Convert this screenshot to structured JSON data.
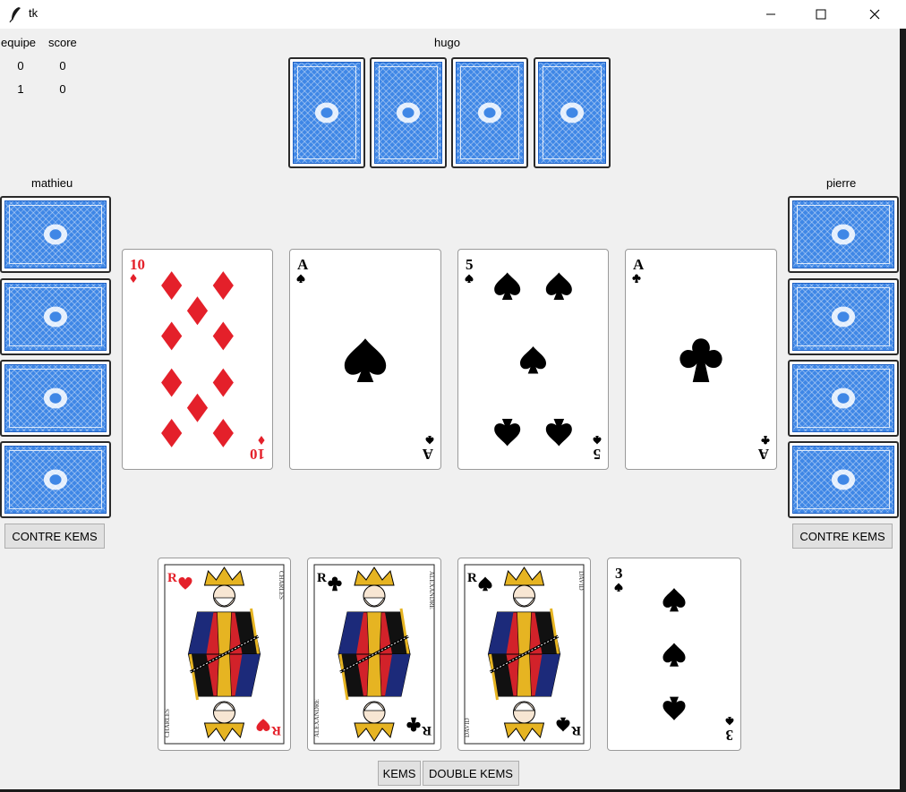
{
  "window": {
    "title": "tk"
  },
  "scoreboard": {
    "headers": [
      "equipe",
      "score"
    ],
    "rows": [
      [
        "0",
        "0"
      ],
      [
        "1",
        "0"
      ]
    ]
  },
  "players": {
    "top": {
      "name": "hugo"
    },
    "left": {
      "name": "mathieu",
      "contre_label": "CONTRE KEMS"
    },
    "right": {
      "name": "pierre",
      "contre_label": "CONTRE KEMS"
    }
  },
  "table_cards": [
    {
      "rank": "10",
      "suit": "diamonds"
    },
    {
      "rank": "A",
      "suit": "spades"
    },
    {
      "rank": "5",
      "suit": "spades"
    },
    {
      "rank": "A",
      "suit": "clubs"
    }
  ],
  "hand_cards": [
    {
      "rank": "R",
      "suit": "hearts",
      "name": "CHARLES"
    },
    {
      "rank": "R",
      "suit": "clubs",
      "name": "ALEXANDRE"
    },
    {
      "rank": "R",
      "suit": "spades",
      "name": "DAVID"
    },
    {
      "rank": "3",
      "suit": "spades"
    }
  ],
  "buttons": {
    "kems": "KEMS",
    "double_kems": "DOUBLE KEMS"
  },
  "colors": {
    "card_back": "#3f87e6",
    "red_suit": "#e4202a",
    "black_suit": "#000000",
    "background": "#f0f0f0"
  }
}
